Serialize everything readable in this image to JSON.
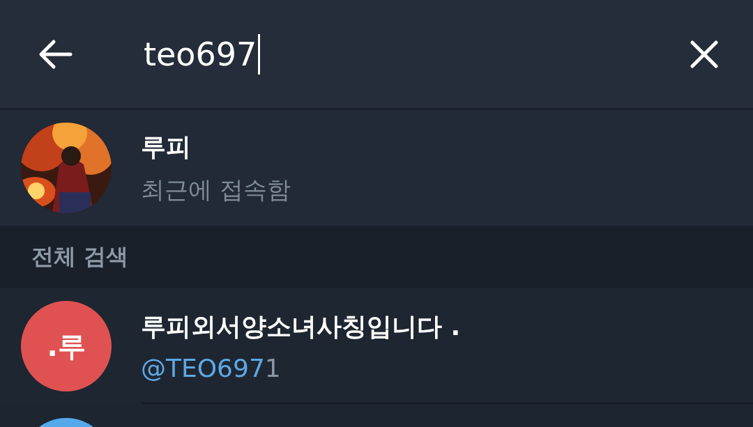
{
  "search_bar": {
    "value": "teo697"
  },
  "contacts": [
    {
      "name": "루피",
      "status": "최근에 접속함"
    }
  ],
  "section_header": "전체 검색",
  "global_results": [
    {
      "name": "루피외서양소녀사칭입니다 .",
      "avatar_initials": ".루",
      "color": "#e05252",
      "handle_match": "@TEO697",
      "handle_rest": "1"
    },
    {
      "color": "#54a9eb"
    }
  ]
}
